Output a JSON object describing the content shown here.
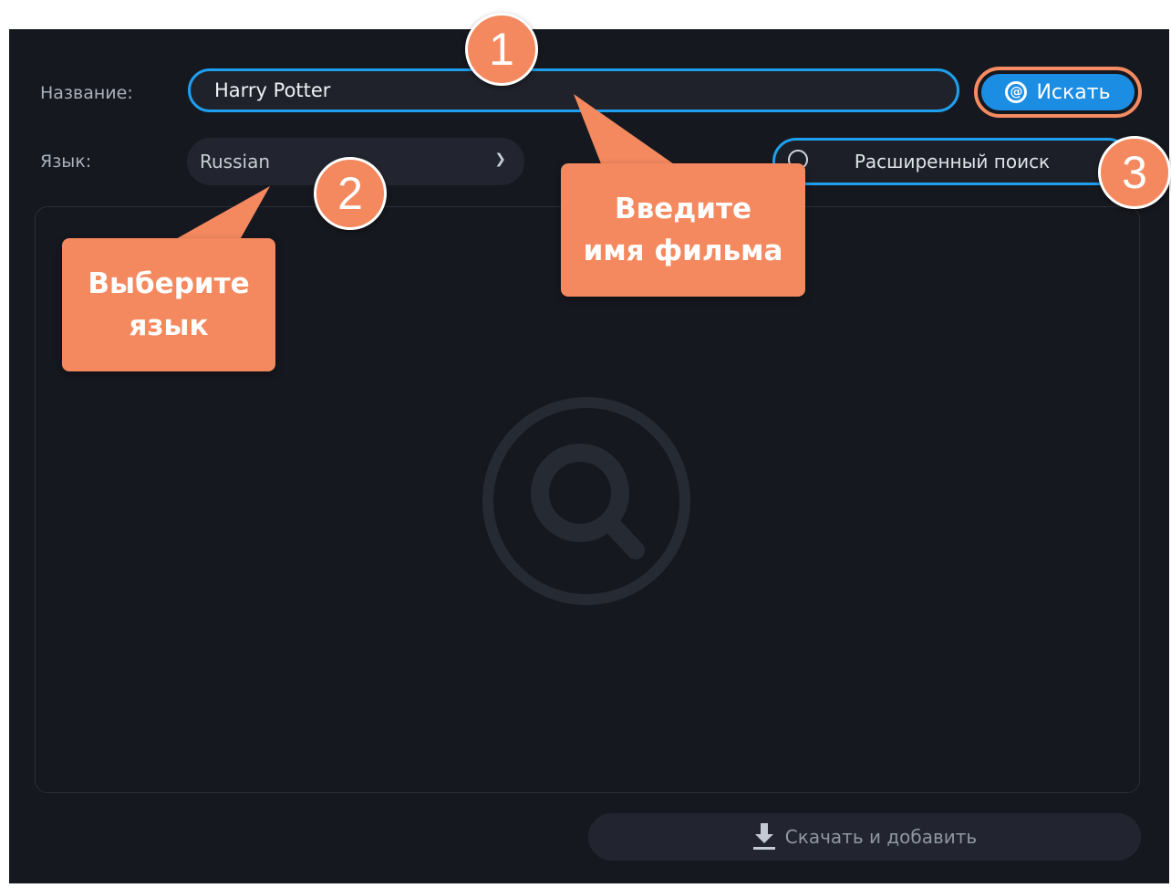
{
  "form": {
    "title_label": "Название:",
    "title_value": "Harry Potter",
    "search_button": "Искать",
    "language_label": "Язык:",
    "language_value": "Russian",
    "advanced_search": "Расширенный поиск"
  },
  "footer": {
    "download_add": "Скачать и добавить"
  },
  "annotations": {
    "badge1": "1",
    "badge2": "2",
    "badge3": "3",
    "callout_title_line1": "Введите",
    "callout_title_line2": "имя фильма",
    "callout_lang_line1": "Выберите",
    "callout_lang_line2": "язык"
  },
  "colors": {
    "background": "#16181f",
    "accent": "#1ea0ef",
    "button": "#1b8de3",
    "annotation": "#f4895f"
  },
  "icons": {
    "search_button_icon": "at-icon",
    "advanced_icon": "circle-icon",
    "dropdown": "chevron-down-icon",
    "placeholder": "magnifier-icon",
    "download": "download-icon"
  }
}
